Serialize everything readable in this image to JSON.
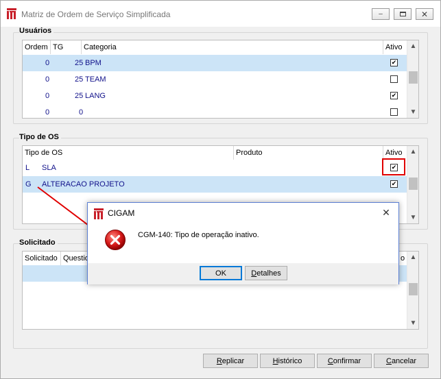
{
  "window": {
    "title": "Matriz de Ordem de Serviço Simplificada",
    "controls": [
      "minimize",
      "restore",
      "close"
    ]
  },
  "usuarios": {
    "label": "Usuários",
    "columns": [
      "Ordem",
      "TG",
      "Categoria",
      "Ativo"
    ],
    "rows": [
      {
        "ordem": "0",
        "tg": "25",
        "categoria": "BPM",
        "ativo": true,
        "selected": true
      },
      {
        "ordem": "0",
        "tg": "25",
        "categoria": "TEAM",
        "ativo": false,
        "selected": false
      },
      {
        "ordem": "0",
        "tg": "25",
        "categoria": "LANG",
        "ativo": true,
        "selected": false
      },
      {
        "ordem": "0",
        "tg": "0",
        "categoria": "",
        "ativo": false,
        "selected": false
      }
    ]
  },
  "tipo_os": {
    "label": "Tipo de OS",
    "columns": [
      "Tipo de OS",
      "Produto",
      "Ativo"
    ],
    "rows": [
      {
        "tipo": "L",
        "descricao": "SLA",
        "ativo": true,
        "selected": false
      },
      {
        "tipo": "G",
        "descricao": "ALTERACAO PROJETO",
        "ativo": true,
        "selected": true
      }
    ]
  },
  "solicitado": {
    "label": "Solicitado",
    "columns": [
      "Solicitado",
      "Question",
      "o"
    ]
  },
  "buttons": {
    "replicar": "Replicar",
    "historico": "Histórico",
    "confirmar": "Confirmar",
    "cancelar": "Cancelar"
  },
  "dialog": {
    "title": "CIGAM",
    "message": "CGM-140: Tipo de operação inativo.",
    "ok": "OK",
    "detalhes": "Detalhes",
    "icon": "error-icon"
  },
  "annotation": {
    "color": "#e00000"
  },
  "colors": {
    "selected_row": "#cce4f7",
    "cell_text": "#10108a",
    "annotation_red": "#e00000"
  }
}
